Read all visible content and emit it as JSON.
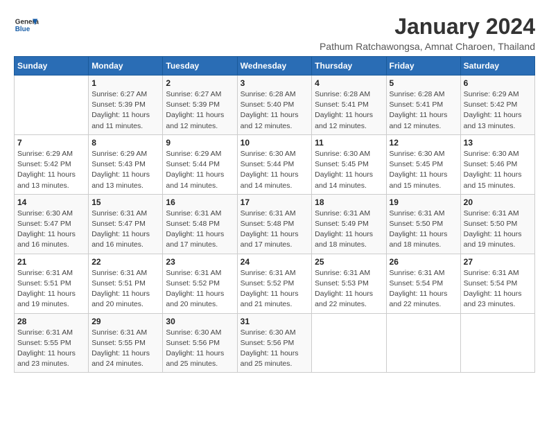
{
  "header": {
    "logo_general": "General",
    "logo_blue": "Blue",
    "title": "January 2024",
    "subtitle": "Pathum Ratchawongsa, Amnat Charoen, Thailand"
  },
  "columns": [
    "Sunday",
    "Monday",
    "Tuesday",
    "Wednesday",
    "Thursday",
    "Friday",
    "Saturday"
  ],
  "weeks": [
    [
      {
        "day": "",
        "info": ""
      },
      {
        "day": "1",
        "info": "Sunrise: 6:27 AM\nSunset: 5:39 PM\nDaylight: 11 hours\nand 11 minutes."
      },
      {
        "day": "2",
        "info": "Sunrise: 6:27 AM\nSunset: 5:39 PM\nDaylight: 11 hours\nand 12 minutes."
      },
      {
        "day": "3",
        "info": "Sunrise: 6:28 AM\nSunset: 5:40 PM\nDaylight: 11 hours\nand 12 minutes."
      },
      {
        "day": "4",
        "info": "Sunrise: 6:28 AM\nSunset: 5:41 PM\nDaylight: 11 hours\nand 12 minutes."
      },
      {
        "day": "5",
        "info": "Sunrise: 6:28 AM\nSunset: 5:41 PM\nDaylight: 11 hours\nand 12 minutes."
      },
      {
        "day": "6",
        "info": "Sunrise: 6:29 AM\nSunset: 5:42 PM\nDaylight: 11 hours\nand 13 minutes."
      }
    ],
    [
      {
        "day": "7",
        "info": "Sunrise: 6:29 AM\nSunset: 5:42 PM\nDaylight: 11 hours\nand 13 minutes."
      },
      {
        "day": "8",
        "info": "Sunrise: 6:29 AM\nSunset: 5:43 PM\nDaylight: 11 hours\nand 13 minutes."
      },
      {
        "day": "9",
        "info": "Sunrise: 6:29 AM\nSunset: 5:44 PM\nDaylight: 11 hours\nand 14 minutes."
      },
      {
        "day": "10",
        "info": "Sunrise: 6:30 AM\nSunset: 5:44 PM\nDaylight: 11 hours\nand 14 minutes."
      },
      {
        "day": "11",
        "info": "Sunrise: 6:30 AM\nSunset: 5:45 PM\nDaylight: 11 hours\nand 14 minutes."
      },
      {
        "day": "12",
        "info": "Sunrise: 6:30 AM\nSunset: 5:45 PM\nDaylight: 11 hours\nand 15 minutes."
      },
      {
        "day": "13",
        "info": "Sunrise: 6:30 AM\nSunset: 5:46 PM\nDaylight: 11 hours\nand 15 minutes."
      }
    ],
    [
      {
        "day": "14",
        "info": "Sunrise: 6:30 AM\nSunset: 5:47 PM\nDaylight: 11 hours\nand 16 minutes."
      },
      {
        "day": "15",
        "info": "Sunrise: 6:31 AM\nSunset: 5:47 PM\nDaylight: 11 hours\nand 16 minutes."
      },
      {
        "day": "16",
        "info": "Sunrise: 6:31 AM\nSunset: 5:48 PM\nDaylight: 11 hours\nand 17 minutes."
      },
      {
        "day": "17",
        "info": "Sunrise: 6:31 AM\nSunset: 5:48 PM\nDaylight: 11 hours\nand 17 minutes."
      },
      {
        "day": "18",
        "info": "Sunrise: 6:31 AM\nSunset: 5:49 PM\nDaylight: 11 hours\nand 18 minutes."
      },
      {
        "day": "19",
        "info": "Sunrise: 6:31 AM\nSunset: 5:50 PM\nDaylight: 11 hours\nand 18 minutes."
      },
      {
        "day": "20",
        "info": "Sunrise: 6:31 AM\nSunset: 5:50 PM\nDaylight: 11 hours\nand 19 minutes."
      }
    ],
    [
      {
        "day": "21",
        "info": "Sunrise: 6:31 AM\nSunset: 5:51 PM\nDaylight: 11 hours\nand 19 minutes."
      },
      {
        "day": "22",
        "info": "Sunrise: 6:31 AM\nSunset: 5:51 PM\nDaylight: 11 hours\nand 20 minutes."
      },
      {
        "day": "23",
        "info": "Sunrise: 6:31 AM\nSunset: 5:52 PM\nDaylight: 11 hours\nand 20 minutes."
      },
      {
        "day": "24",
        "info": "Sunrise: 6:31 AM\nSunset: 5:52 PM\nDaylight: 11 hours\nand 21 minutes."
      },
      {
        "day": "25",
        "info": "Sunrise: 6:31 AM\nSunset: 5:53 PM\nDaylight: 11 hours\nand 22 minutes."
      },
      {
        "day": "26",
        "info": "Sunrise: 6:31 AM\nSunset: 5:54 PM\nDaylight: 11 hours\nand 22 minutes."
      },
      {
        "day": "27",
        "info": "Sunrise: 6:31 AM\nSunset: 5:54 PM\nDaylight: 11 hours\nand 23 minutes."
      }
    ],
    [
      {
        "day": "28",
        "info": "Sunrise: 6:31 AM\nSunset: 5:55 PM\nDaylight: 11 hours\nand 23 minutes."
      },
      {
        "day": "29",
        "info": "Sunrise: 6:31 AM\nSunset: 5:55 PM\nDaylight: 11 hours\nand 24 minutes."
      },
      {
        "day": "30",
        "info": "Sunrise: 6:30 AM\nSunset: 5:56 PM\nDaylight: 11 hours\nand 25 minutes."
      },
      {
        "day": "31",
        "info": "Sunrise: 6:30 AM\nSunset: 5:56 PM\nDaylight: 11 hours\nand 25 minutes."
      },
      {
        "day": "",
        "info": ""
      },
      {
        "day": "",
        "info": ""
      },
      {
        "day": "",
        "info": ""
      }
    ]
  ]
}
